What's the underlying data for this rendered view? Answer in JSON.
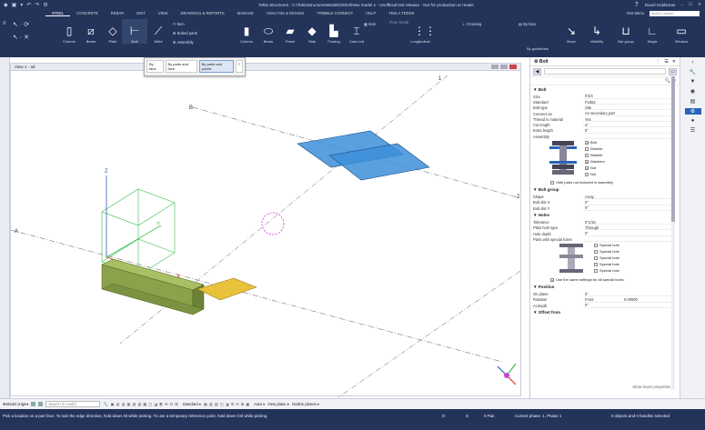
{
  "titlebar": {
    "title": "Tekla Structures - C:\\TeklaStructuresModels\\2024\\New model 1 - Unofficial test release - Not for production or resale",
    "user": "David Holdsman",
    "window_controls": [
      "–",
      "☐",
      "✕"
    ]
  },
  "ribbon": {
    "tabs": [
      "STEEL",
      "CONCRETE",
      "REBAR",
      "EDIT",
      "VIEW",
      "DRAWINGS & REPORTS",
      "MANAGE",
      "ANALYSIS & DESIGN",
      "TRIMBLE CONNECT",
      "HELP",
      "TEKLA TEDDS"
    ],
    "active_tab": "STEEL",
    "test_menu": "Test Menu",
    "quick_launch": "Quick Launch",
    "buttons": [
      {
        "label": "Column",
        "icon": "column-icon"
      },
      {
        "label": "Beam",
        "icon": "beam-icon"
      },
      {
        "label": "Plate",
        "icon": "plate-icon"
      },
      {
        "label": "Bolt",
        "icon": "bolt-icon"
      },
      {
        "label": "Weld",
        "icon": "weld-icon"
      },
      {
        "label": "Column",
        "icon": "concrete-column-icon"
      },
      {
        "label": "Beam",
        "icon": "concrete-beam-icon"
      },
      {
        "label": "Panel",
        "icon": "panel-icon"
      },
      {
        "label": "Slab",
        "icon": "slab-icon"
      },
      {
        "label": "Footing",
        "icon": "footing-icon"
      },
      {
        "label": "Cast unit",
        "icon": "cast-unit-icon"
      },
      {
        "label": "Longitudinal",
        "icon": "longitudinal-icon"
      },
      {
        "label": "By guidelines",
        "icon": "guidelines-icon"
      },
      {
        "label": "Move",
        "icon": "move-icon"
      },
      {
        "label": "Visibility",
        "icon": "visibility-icon"
      },
      {
        "label": "Bar group",
        "icon": "bar-group-icon"
      },
      {
        "label": "Single",
        "icon": "single-icon"
      },
      {
        "label": "Window",
        "icon": "window-icon"
      }
    ],
    "small_items": {
      "item": "Item",
      "bolted_parts": "Bolted parts",
      "assembly": "Assembly",
      "item2": "Item",
      "floor_break": "Floor break",
      "crossing": "Crossing",
      "by_face": "By face"
    }
  },
  "tooltip": {
    "options": [
      "By face",
      "By parts and face",
      "By parts and points"
    ],
    "selected": "By parts and points"
  },
  "viewport": {
    "title": "View 1 - 3d",
    "grid_labels": [
      "1",
      "B",
      "A",
      "Z",
      "Y",
      "X",
      "2"
    ]
  },
  "panel": {
    "title": "Bolt",
    "section_bolt": "Bolt",
    "bolt_rows": [
      {
        "k": "Size",
        "v": "0'3/4",
        "dd": true
      },
      {
        "k": "Standard",
        "v": "F1852",
        "dd": true
      },
      {
        "k": "Bolt type",
        "v": "Site",
        "dd": true
      },
      {
        "k": "Connect as",
        "v": "As secondary part",
        "dd": true
      },
      {
        "k": "Thread in material",
        "v": "Yes",
        "dd": true
      },
      {
        "k": "Cut length",
        "v": "4\"",
        "dd": false
      },
      {
        "k": "Extra length",
        "v": "0\"",
        "dd": false
      },
      {
        "k": "Assembly",
        "v": "",
        "dd": false
      }
    ],
    "assembly_checks": [
      {
        "label": "Bolt",
        "checked": true
      },
      {
        "label": "Washer",
        "checked": false
      },
      {
        "label": "Washer",
        "checked": false
      },
      {
        "label": "Washers",
        "checked": true
      },
      {
        "label": "Nut",
        "checked": true
      },
      {
        "label": "Nut",
        "checked": false
      }
    ],
    "hide_parts": "Hide parts not included in assembly",
    "section_group": "Bolt group",
    "group_rows": [
      {
        "k": "Shape",
        "v": "Array",
        "dd": true
      },
      {
        "k": "Bolt dist X",
        "v": "0\"",
        "dd": false
      },
      {
        "k": "Bolt dist Y",
        "v": "0\"",
        "dd": false
      }
    ],
    "section_holes": "Holes",
    "hole_rows": [
      {
        "k": "Tolerance",
        "v": "0\"1/16",
        "dd": false
      },
      {
        "k": "Plain hole type",
        "v": "Through",
        "dd": true
      },
      {
        "k": "Hole depth",
        "v": "0\"",
        "dd": false
      },
      {
        "k": "Parts with special holes",
        "v": "",
        "dd": false
      }
    ],
    "special_holes": [
      "Special hole",
      "Special hole",
      "Special hole",
      "Special hole",
      "Special hole"
    ],
    "same_settings": "Use the same settings for all special holes",
    "section_position": "Position",
    "position_rows": [
      {
        "k": "On plane",
        "v": "0\"",
        "dd": false
      },
      {
        "k": "Rotation",
        "v": "Front",
        "dd": true
      },
      {
        "k": "At depth",
        "v": "0\"",
        "dd": false
      }
    ],
    "rotation_value": "0.00000",
    "section_offset": "Offset from",
    "show_fewer": "Show fewer properties"
  },
  "bottombar": {
    "model_origin": "Model origin",
    "search_placeholder": "Search in model",
    "standard": "Standard",
    "auto": "Auto",
    "view_plane": "View plane",
    "outline_planes": "Outline planes"
  },
  "statusbar": {
    "message": "Pick a location on a part face. To lock the edge direction, hold down Alt while picking. To use a temporary reference point, hold down Ctrl while picking.",
    "o": "O",
    "s": "S",
    "pan": "0 Pan",
    "plane": "Current phase: 1, Phase 1",
    "objects": "0 objects and 0 handles selected"
  },
  "colors": {
    "dark_navy": "#23335a",
    "accent_blue": "#2a63b8",
    "plate_blue": "#3d8fd9",
    "beam_green": "#8aa24a",
    "plate_yellow": "#e8c23a"
  }
}
